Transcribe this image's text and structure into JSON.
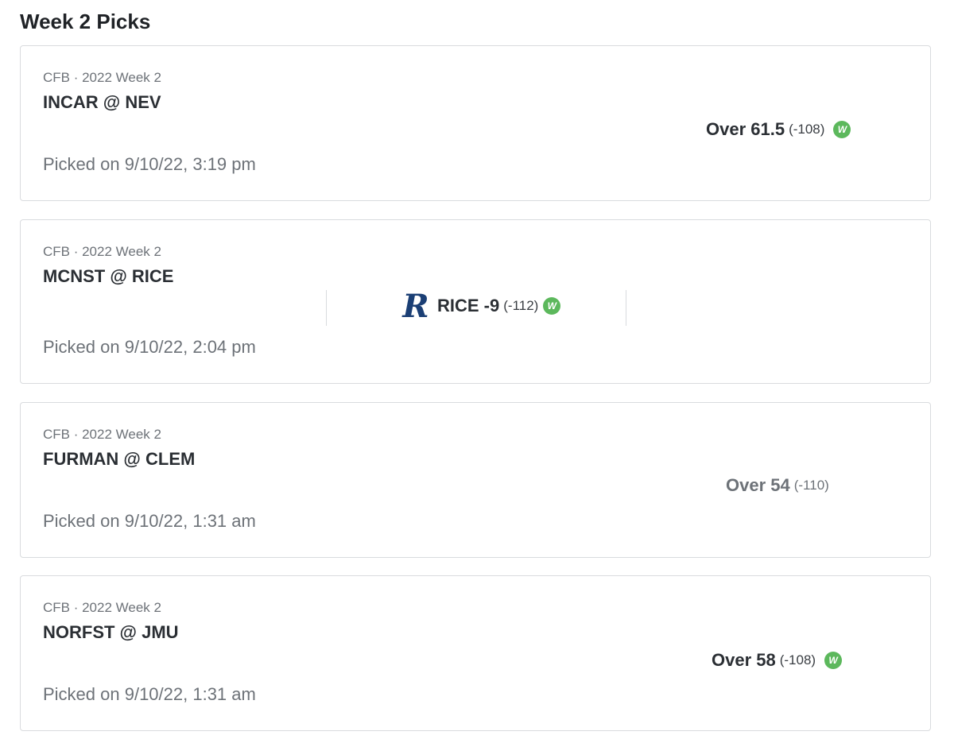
{
  "page": {
    "title": "Week 2 Picks"
  },
  "picks": [
    {
      "meta": "CFB · 2022 Week 2",
      "matchup": "INCAR @ NEV",
      "pick_label": "Over 61.5",
      "odds": "(-108)",
      "result_badge": "W",
      "picked_on": "Picked on 9/10/22, 3:19 pm"
    },
    {
      "meta": "CFB · 2022 Week 2",
      "matchup": "MCNST @ RICE",
      "pick_label": "RICE -9",
      "odds": "(-112)",
      "result_badge": "W",
      "team_logo_icon": "rice-owls-logo-icon",
      "team_logo_letter": "R",
      "team_logo_color": "#1b3f75",
      "picked_on": "Picked on 9/10/22, 2:04 pm"
    },
    {
      "meta": "CFB · 2022 Week 2",
      "matchup": "FURMAN @ CLEM",
      "pick_label": "Over 54",
      "odds": "(-110)",
      "picked_on": "Picked on 9/10/22, 1:31 am"
    },
    {
      "meta": "CFB · 2022 Week 2",
      "matchup": "NORFST @ JMU",
      "pick_label": "Over 58",
      "odds": "(-108)",
      "result_badge": "W",
      "picked_on": "Picked on 9/10/22, 1:31 am"
    }
  ],
  "colors": {
    "win_badge": "#5cb85c",
    "border": "#d9dbde",
    "muted_text": "#6d7278"
  }
}
